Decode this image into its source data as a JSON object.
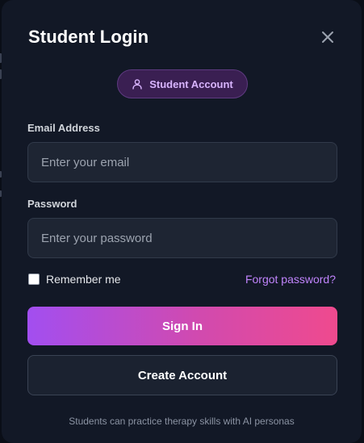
{
  "modal": {
    "title": "Student Login",
    "close_icon": "close-icon"
  },
  "badge": {
    "icon": "user-icon",
    "label": "Student Account",
    "color": "#d8b4fe"
  },
  "email": {
    "label": "Email Address",
    "value": "",
    "placeholder": "Enter your email"
  },
  "password": {
    "label": "Password",
    "value": "",
    "placeholder": "Enter your password"
  },
  "remember": {
    "label": "Remember me",
    "checked": false
  },
  "forgot_link": "Forgot password?",
  "buttons": {
    "sign_in": "Sign In",
    "create_account": "Create Account"
  },
  "footer_note": "Students can practice therapy skills with AI personas",
  "colors": {
    "background": "#121826",
    "accent_purple": "#c084fc",
    "gradient_start": "#a24ef0",
    "gradient_end": "#ef4a8e"
  }
}
